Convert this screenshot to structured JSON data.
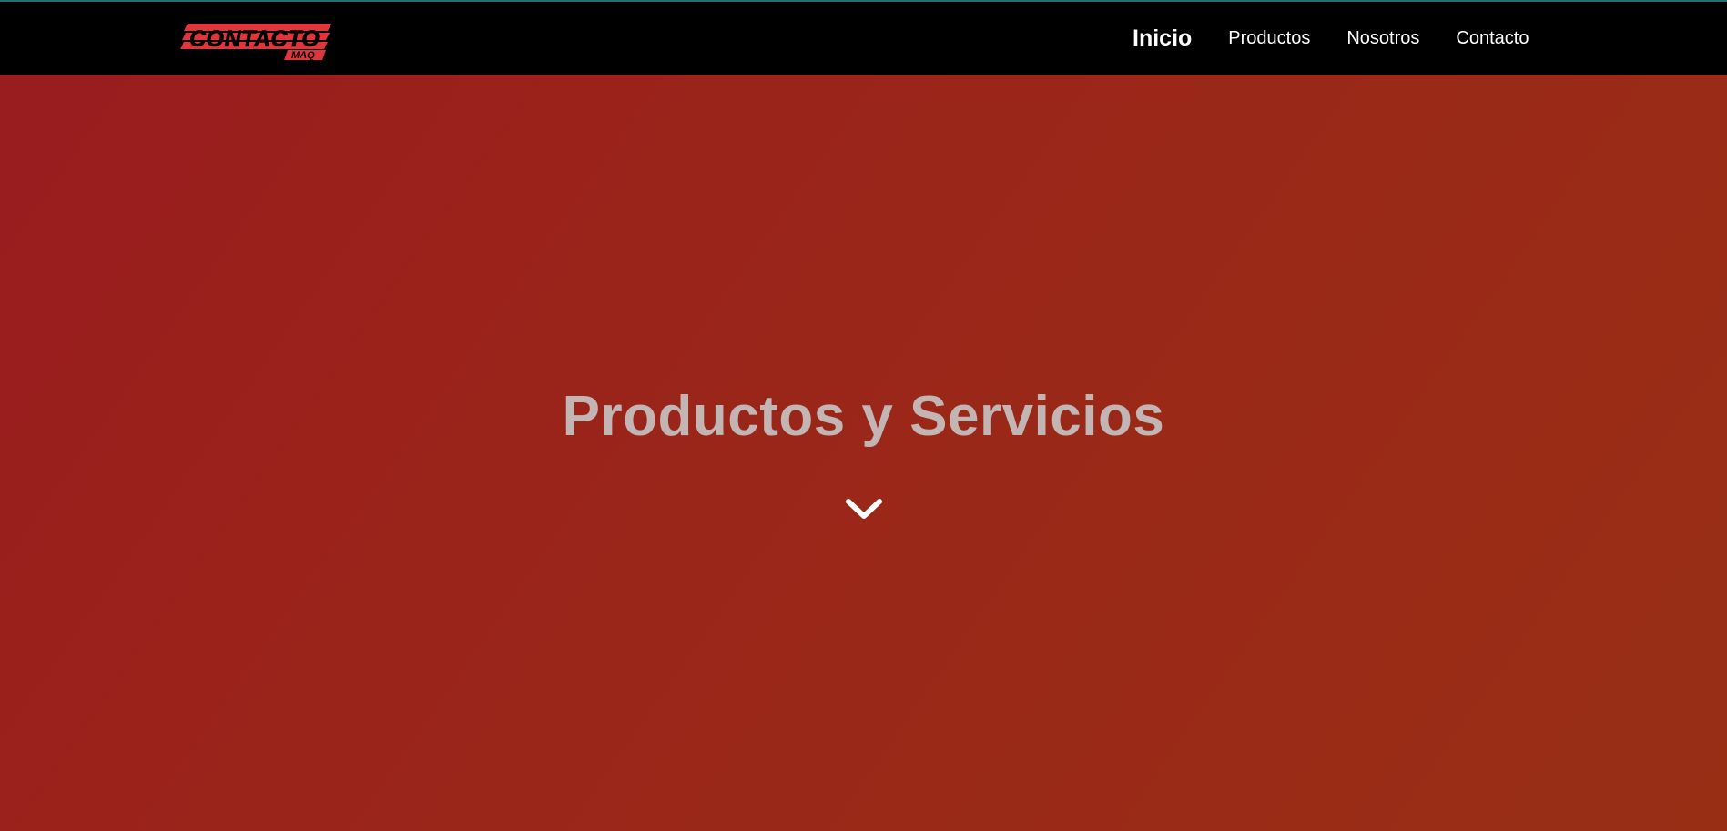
{
  "header": {
    "logo_text": "CONTACTO",
    "logo_subtext": "MAQ",
    "nav": [
      {
        "label": "Inicio",
        "active": true
      },
      {
        "label": "Productos",
        "active": false
      },
      {
        "label": "Nosotros",
        "active": false
      },
      {
        "label": "Contacto",
        "active": false
      }
    ]
  },
  "hero": {
    "title": "Productos y Servicios",
    "scroll_icon": "chevron-down-icon"
  },
  "colors": {
    "navbar_bg": "#000000",
    "hero_gradient_start": "#991c1e",
    "hero_gradient_end": "#982f15",
    "title_color": "#c2b5b3",
    "logo_red": "#e0353a",
    "top_accent": "#1f6f73"
  }
}
